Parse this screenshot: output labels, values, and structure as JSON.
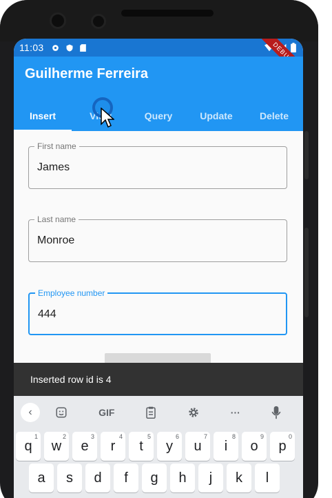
{
  "status_bar": {
    "time": "11:03"
  },
  "debug_banner": "DEBUG",
  "app_bar": {
    "title": "Guilherme Ferreira",
    "tabs": [
      {
        "label": "Insert",
        "active": true
      },
      {
        "label": "View",
        "active": false
      },
      {
        "label": "Query",
        "active": false
      },
      {
        "label": "Update",
        "active": false
      },
      {
        "label": "Delete",
        "active": false
      }
    ]
  },
  "form": {
    "first_name": {
      "label": "First name",
      "value": "James"
    },
    "last_name": {
      "label": "Last name",
      "value": "Monroe"
    },
    "employee_number": {
      "label": "Employee number",
      "value": "444"
    }
  },
  "snackbar": {
    "message": "Inserted row id is 4"
  },
  "keyboard": {
    "toolbar": [
      "GIF"
    ],
    "row1": [
      {
        "key": "q",
        "hint": "1"
      },
      {
        "key": "w",
        "hint": "2"
      },
      {
        "key": "e",
        "hint": "3"
      },
      {
        "key": "r",
        "hint": "4"
      },
      {
        "key": "t",
        "hint": "5"
      },
      {
        "key": "y",
        "hint": "6"
      },
      {
        "key": "u",
        "hint": "7"
      },
      {
        "key": "i",
        "hint": "8"
      },
      {
        "key": "o",
        "hint": "9"
      },
      {
        "key": "p",
        "hint": "0"
      }
    ],
    "row2": [
      "a",
      "s",
      "d",
      "f",
      "g",
      "h",
      "j",
      "k",
      "l"
    ]
  },
  "colors": {
    "primary": "#2196f3",
    "status_bar": "#1976d2",
    "snackbar": "#323232",
    "debug_ribbon": "#b71c1c"
  }
}
